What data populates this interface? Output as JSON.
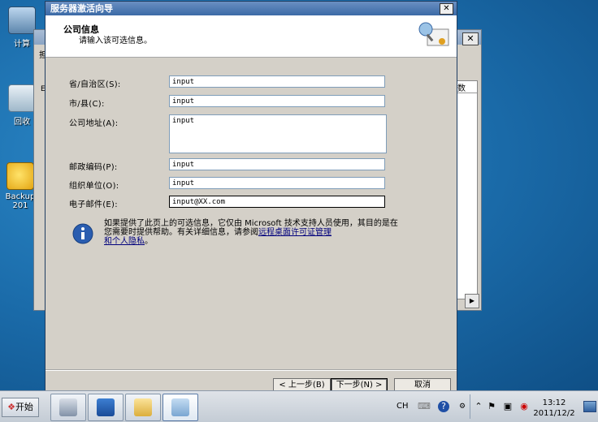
{
  "desktop": {
    "icons": [
      {
        "label": "计算"
      },
      {
        "label": "回收"
      },
      {
        "label": "Backup"
      },
      {
        "label": "201"
      }
    ]
  },
  "background_window": {
    "close_glyph": "✕",
    "column_header": "数",
    "scroll_right_glyph": "▶",
    "left_snippets": [
      "担",
      "El"
    ]
  },
  "wizard": {
    "title": "服务器激活向导",
    "close_glyph": "✕",
    "header": {
      "title": "公司信息",
      "subtitle": "请输入该可选信息。"
    },
    "fields": {
      "province": {
        "label": "省/自治区(S):",
        "value": "input"
      },
      "city": {
        "label": "市/县(C):",
        "value": "input"
      },
      "address": {
        "label": "公司地址(A):",
        "value": "input"
      },
      "postal": {
        "label": "邮政编码(P):",
        "value": "input"
      },
      "org": {
        "label": "组织单位(O):",
        "value": "input"
      },
      "email": {
        "label": "电子邮件(E):",
        "value": "input@XX.com"
      }
    },
    "info": {
      "text": "如果提供了此页上的可选信息，它仅由 Microsoft 技术支持人员使用，其目的是在您需要时提供帮助。有关详细信息，请参阅",
      "link1": "远程桌面许可证管理",
      "link2": "和个人隐私",
      "end": "。"
    },
    "buttons": {
      "back": "< 上一步(B)",
      "next": "下一步(N) >",
      "cancel": "取消"
    }
  },
  "taskbar": {
    "start_label": "开始",
    "language": "CH",
    "time": "13:12",
    "date": "2011/12/2"
  },
  "colors": {
    "desktop": "#1c6ea8",
    "title_bar": "#3b6aa6",
    "link": "#00007c"
  }
}
